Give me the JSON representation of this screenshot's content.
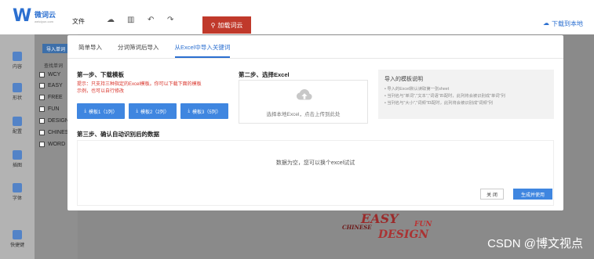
{
  "app": {
    "logo_mark": "W",
    "logo_name": "微词云",
    "logo_sub": "weiciyun.com",
    "menu_file": "文件",
    "load_button": "加载词云",
    "download_local": "下载到本地"
  },
  "sidebar": {
    "items": [
      {
        "label": "内容",
        "icon": "content-icon"
      },
      {
        "label": "形状",
        "icon": "shape-icon"
      },
      {
        "label": "配置",
        "icon": "config-icon"
      },
      {
        "label": "插图",
        "icon": "illustration-icon"
      },
      {
        "label": "字体",
        "icon": "font-icon"
      },
      {
        "label": "快捷键",
        "icon": "shortcut-icon"
      }
    ]
  },
  "panel": {
    "import_word_button": "导入单词",
    "search_label": "查找单词",
    "words": [
      "WCY",
      "EASY",
      "FREE",
      "FUN",
      "DESIGN",
      "CHINESE",
      "WORD"
    ]
  },
  "modal": {
    "tabs": [
      {
        "label": "简单导入",
        "active": false
      },
      {
        "label": "分词筛词后导入",
        "active": false
      },
      {
        "label": "从Excel中导入关键词",
        "active": true
      }
    ],
    "step1": {
      "title": "第一步、下载模板",
      "hint": "提示：只支持三种指定的Excel模板。你可以下载下面的模板示例，也可以自行修改",
      "templates": [
        "模板1（1列）",
        "模板2（2列）",
        "模板3（5列）"
      ]
    },
    "step2": {
      "title": "第二步、选择Excel",
      "upload_text": "选择本地Excel，点击上传到此处"
    },
    "tips": {
      "title": "导入的模板说明",
      "lines": [
        "• 导入的Excel默认读取第一张sheet",
        "• 当列名与\"单词\",\"文本\",\"词语\"匹配时，此列将会被识别成\"单词\"列",
        "• 当列名与\"大小\",\"词频\"匹配时，此列将会被识别成\"词频\"列"
      ]
    },
    "step3": {
      "title": "第三步、确认自动识别后的数据",
      "empty_text": "数据为空，您可以换个excel试试"
    },
    "close_button": "关 闭",
    "generate_button": "生成并使用"
  },
  "watermark": "CSDN @博文视点",
  "colors": {
    "accent": "#3f86e0",
    "brand": "#2b6fd0",
    "danger": "#d9342b",
    "load_button": "#c0392b"
  }
}
